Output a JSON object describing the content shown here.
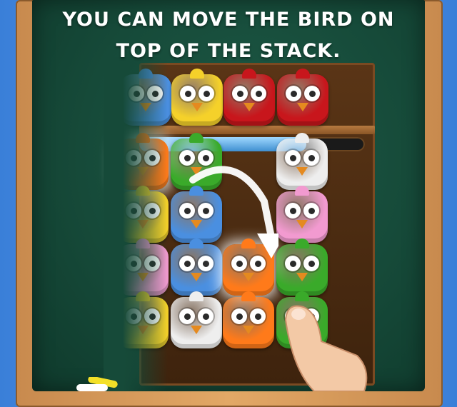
{
  "tutorial": {
    "line1": "YOU CAN MOVE THE BIRD ON",
    "line2": "TOP OF THE STACK."
  },
  "progress": {
    "fraction": 0.74,
    "color": "#4a9be0"
  },
  "colors": {
    "board": "#164a39",
    "frame": "#d49a5c",
    "orange": "#ff7a1a",
    "yellow": "#f5d12a",
    "red": "#c8161c",
    "white": "#eeeeee",
    "blue": "#4a8fe0",
    "pink": "#f29ad0",
    "green": "#3aaa2a"
  },
  "top_row": [
    "blue",
    "yellow",
    "red",
    "red"
  ],
  "grid": [
    {
      "color": "orange",
      "col": 0,
      "row": 0,
      "highlight": true
    },
    {
      "color": "green",
      "col": 1,
      "row": 0
    },
    {
      "color": "white",
      "col": 3,
      "row": 0
    },
    {
      "color": "yellow",
      "col": 0,
      "row": 1
    },
    {
      "color": "blue",
      "col": 1,
      "row": 1
    },
    {
      "color": "pink",
      "col": 3,
      "row": 1
    },
    {
      "color": "pink",
      "col": 0,
      "row": 2
    },
    {
      "color": "blue",
      "col": 1,
      "row": 2
    },
    {
      "color": "orange",
      "col": 2,
      "row": 2,
      "highlight": true
    },
    {
      "color": "green",
      "col": 3,
      "row": 2
    },
    {
      "color": "yellow",
      "col": 0,
      "row": 3
    },
    {
      "color": "white",
      "col": 1,
      "row": 3
    },
    {
      "color": "orange",
      "col": 2,
      "row": 3
    },
    {
      "color": "green",
      "col": 3,
      "row": 3
    }
  ],
  "icons": [
    "arrow-icon",
    "hand-pointer-icon",
    "chalk-icon"
  ]
}
